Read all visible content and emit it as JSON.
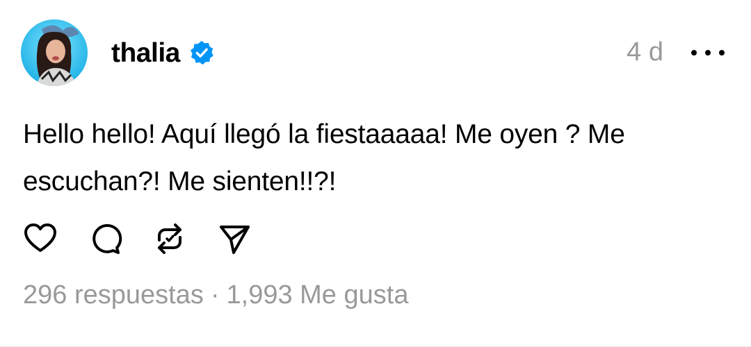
{
  "post": {
    "author": {
      "username": "thalia",
      "verified": true
    },
    "timestamp": "4 d",
    "text_lines": [
      "Hello hello! Aquí llegó la fiestaaaaa! Me oyen ? Me",
      "escuchan?! Me sienten!!?!"
    ],
    "actions": [
      {
        "name": "like",
        "icon": "heart-icon"
      },
      {
        "name": "reply",
        "icon": "comment-icon"
      },
      {
        "name": "repost",
        "icon": "repost-icon"
      },
      {
        "name": "share",
        "icon": "send-icon"
      }
    ],
    "stats": {
      "replies": "296 respuestas",
      "separator": "·",
      "likes": "1,993 Me gusta"
    }
  },
  "colors": {
    "text": "#000000",
    "muted": "#999999",
    "verified_badge": "#0095F6"
  }
}
